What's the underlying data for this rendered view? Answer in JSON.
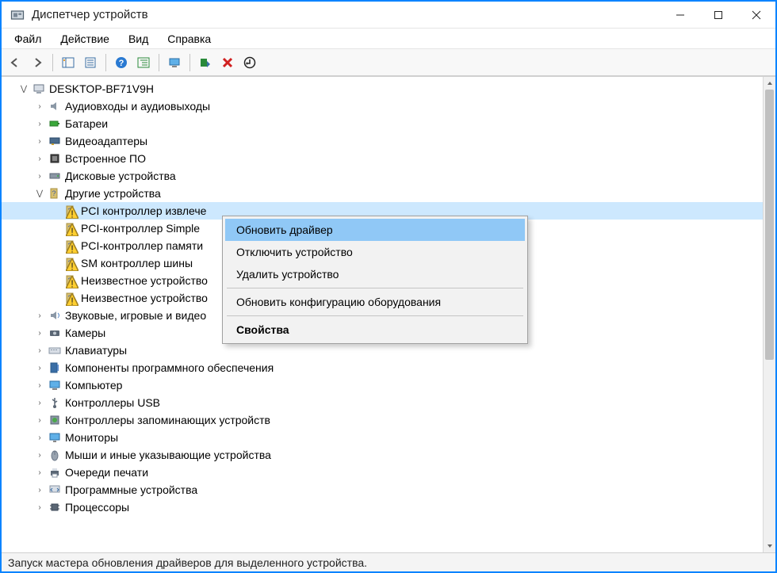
{
  "window": {
    "title": "Диспетчер устройств"
  },
  "menu": {
    "file": "Файл",
    "action": "Действие",
    "view": "Вид",
    "help": "Справка"
  },
  "toolbar": {
    "back": "back-icon",
    "forward": "forward-icon",
    "showhide": "showhide-icon",
    "props": "props-icon",
    "help": "help-icon",
    "showtree": "showtree-icon",
    "computer": "computer-icon",
    "scan": "scan-icon",
    "remove": "remove-icon",
    "refresh": "refresh-icon"
  },
  "tree": {
    "root": "DESKTOP-BF71V9H",
    "items": [
      {
        "label": "Аудиовходы и аудиовыходы",
        "icon": "speaker-icon",
        "exp": "collapsed"
      },
      {
        "label": "Батареи",
        "icon": "battery-icon",
        "exp": "collapsed"
      },
      {
        "label": "Видеоадаптеры",
        "icon": "gpu-icon",
        "exp": "collapsed"
      },
      {
        "label": "Встроенное ПО",
        "icon": "firmware-icon",
        "exp": "collapsed"
      },
      {
        "label": "Дисковые устройства",
        "icon": "disk-icon",
        "exp": "collapsed"
      },
      {
        "label": "Другие устройства",
        "icon": "unknown-icon",
        "exp": "expanded",
        "children": [
          {
            "label": "PCI контроллер извлече",
            "icon": "unknown-warn-icon",
            "selected": true
          },
          {
            "label": "PCI-контроллер Simple",
            "icon": "unknown-warn-icon"
          },
          {
            "label": "PCI-контроллер памяти",
            "icon": "unknown-warn-icon"
          },
          {
            "label": "SM контроллер шины",
            "icon": "unknown-warn-icon"
          },
          {
            "label": "Неизвестное устройство",
            "icon": "unknown-warn-icon"
          },
          {
            "label": "Неизвестное устройство",
            "icon": "unknown-warn-icon"
          }
        ]
      },
      {
        "label": "Звуковые, игровые и видео",
        "icon": "sound-icon",
        "exp": "collapsed"
      },
      {
        "label": "Камеры",
        "icon": "camera-icon",
        "exp": "collapsed"
      },
      {
        "label": "Клавиатуры",
        "icon": "keyboard-icon",
        "exp": "collapsed"
      },
      {
        "label": "Компоненты программного обеспечения",
        "icon": "software-icon",
        "exp": "collapsed"
      },
      {
        "label": "Компьютер",
        "icon": "computer-icon",
        "exp": "collapsed"
      },
      {
        "label": "Контроллеры USB",
        "icon": "usb-icon",
        "exp": "collapsed"
      },
      {
        "label": "Контроллеры запоминающих устройств",
        "icon": "storage-icon",
        "exp": "collapsed"
      },
      {
        "label": "Мониторы",
        "icon": "monitor-icon",
        "exp": "collapsed"
      },
      {
        "label": "Мыши и иные указывающие устройства",
        "icon": "mouse-icon",
        "exp": "collapsed"
      },
      {
        "label": "Очереди печати",
        "icon": "printer-icon",
        "exp": "collapsed"
      },
      {
        "label": "Программные устройства",
        "icon": "software-dev-icon",
        "exp": "collapsed"
      },
      {
        "label": "Процессоры",
        "icon": "cpu-icon",
        "exp": "collapsed"
      }
    ]
  },
  "context": {
    "update": "Обновить драйвер",
    "disable": "Отключить устройство",
    "delete": "Удалить устройство",
    "rescan": "Обновить конфигурацию оборудования",
    "props": "Свойства"
  },
  "status": "Запуск мастера обновления драйверов для выделенного устройства."
}
